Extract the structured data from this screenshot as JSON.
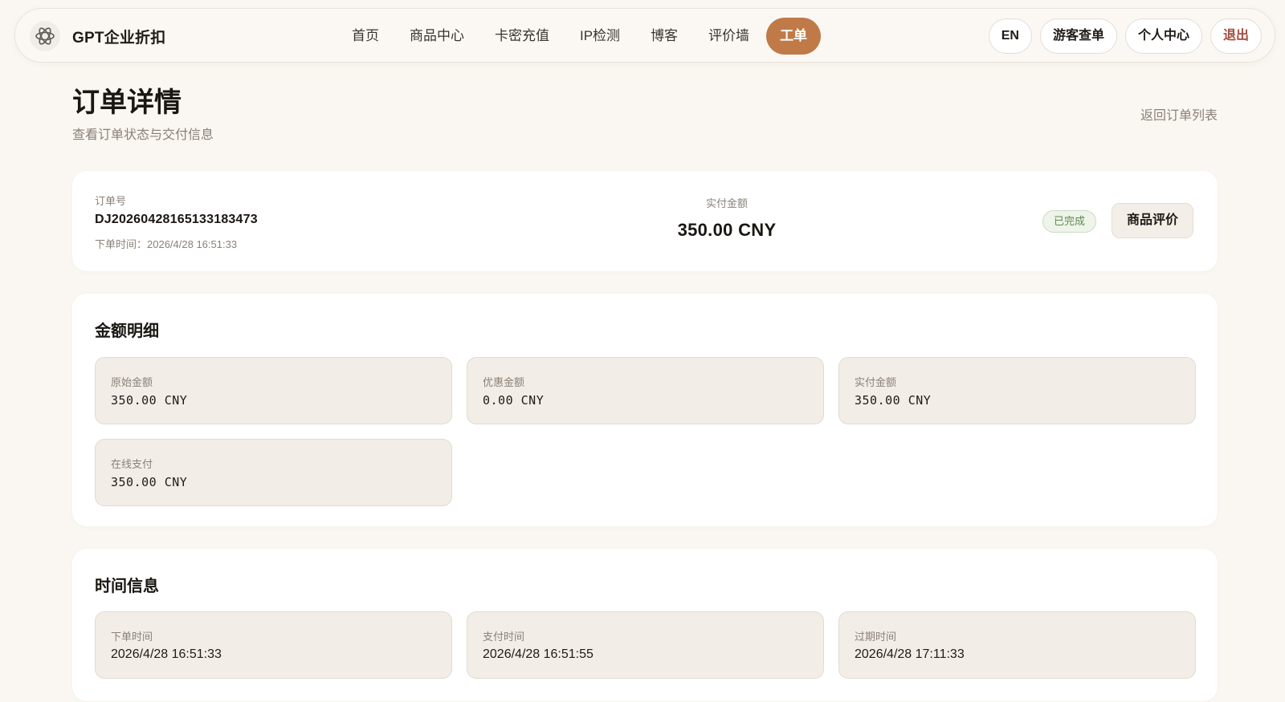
{
  "header": {
    "brand_name": "GPT企业折扣",
    "logo_icon": "brand-logo-icon",
    "nav": [
      {
        "label": "首页",
        "active": false
      },
      {
        "label": "商品中心",
        "active": false
      },
      {
        "label": "卡密充值",
        "active": false
      },
      {
        "label": "IP检测",
        "active": false
      },
      {
        "label": "博客",
        "active": false
      },
      {
        "label": "评价墙",
        "active": false
      },
      {
        "label": "工单",
        "active": true
      }
    ],
    "lang_button": "EN",
    "guest_orders_button": "游客查单",
    "profile_button": "个人中心",
    "logout_button": "退出"
  },
  "page": {
    "title": "订单详情",
    "subtitle": "查看订单状态与交付信息",
    "back_link": "返回订单列表"
  },
  "summary": {
    "order_no_label": "订单号",
    "order_no": "DJ20260428165133183473",
    "order_time": "下单时间：2026/4/28 16:51:33",
    "paid_label": "实付金额",
    "paid_amount": "350.00 CNY",
    "status": "已完成",
    "review_button": "商品评价"
  },
  "amount_details": {
    "title": "金额明细",
    "items": [
      {
        "label": "原始金额",
        "value": "350.00 CNY"
      },
      {
        "label": "优惠金额",
        "value": "0.00 CNY"
      },
      {
        "label": "实付金额",
        "value": "350.00 CNY"
      },
      {
        "label": "在线支付",
        "value": "350.00 CNY"
      }
    ]
  },
  "time_info": {
    "title": "时间信息",
    "items": [
      {
        "label": "下单时间",
        "value": "2026/4/28 16:51:33"
      },
      {
        "label": "支付时间",
        "value": "2026/4/28 16:51:55"
      },
      {
        "label": "过期时间",
        "value": "2026/4/28 17:11:33"
      }
    ]
  },
  "colors": {
    "accent": "#bf7a48",
    "background": "#faf6f1",
    "status_green": "#5d8a4e",
    "logout_red": "#a64a3d"
  }
}
